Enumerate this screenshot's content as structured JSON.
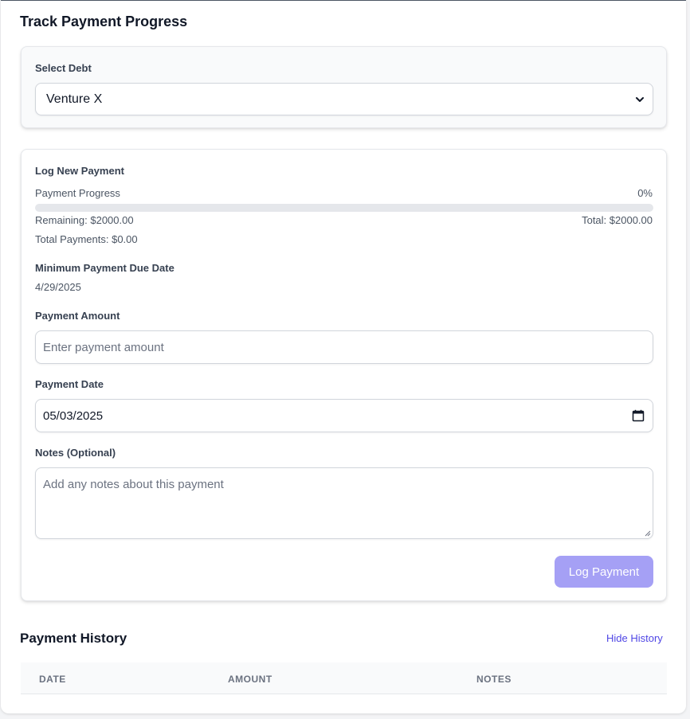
{
  "page": {
    "title": "Track Payment Progress"
  },
  "select_debt": {
    "label": "Select Debt",
    "value": "Venture X"
  },
  "log_payment": {
    "heading": "Log New Payment",
    "progress_label": "Payment Progress",
    "progress_percent_text": "0%",
    "progress_fraction": 0,
    "remaining": "Remaining: $2000.00",
    "total": "Total: $2000.00",
    "total_payments": "Total Payments: $0.00",
    "due_date_label": "Minimum Payment Due Date",
    "due_date_value": "4/29/2025",
    "amount_label": "Payment Amount",
    "amount_placeholder": "Enter payment amount",
    "date_label": "Payment Date",
    "date_value": "05/03/2025",
    "notes_label": "Notes (Optional)",
    "notes_placeholder": "Add any notes about this payment",
    "submit_label": "Log Payment"
  },
  "history": {
    "title": "Payment History",
    "toggle_label": "Hide History",
    "columns": [
      "DATE",
      "AMOUNT",
      "NOTES"
    ]
  },
  "colors": {
    "accent": "#4f46e5",
    "button_disabled": "#a5a0f5",
    "progress_track": "#e5e7eb"
  },
  "icons": {
    "select_chevron": "chevron-down-icon",
    "date_picker": "calendar-icon",
    "textarea_resize": "resize-handle-icon"
  }
}
